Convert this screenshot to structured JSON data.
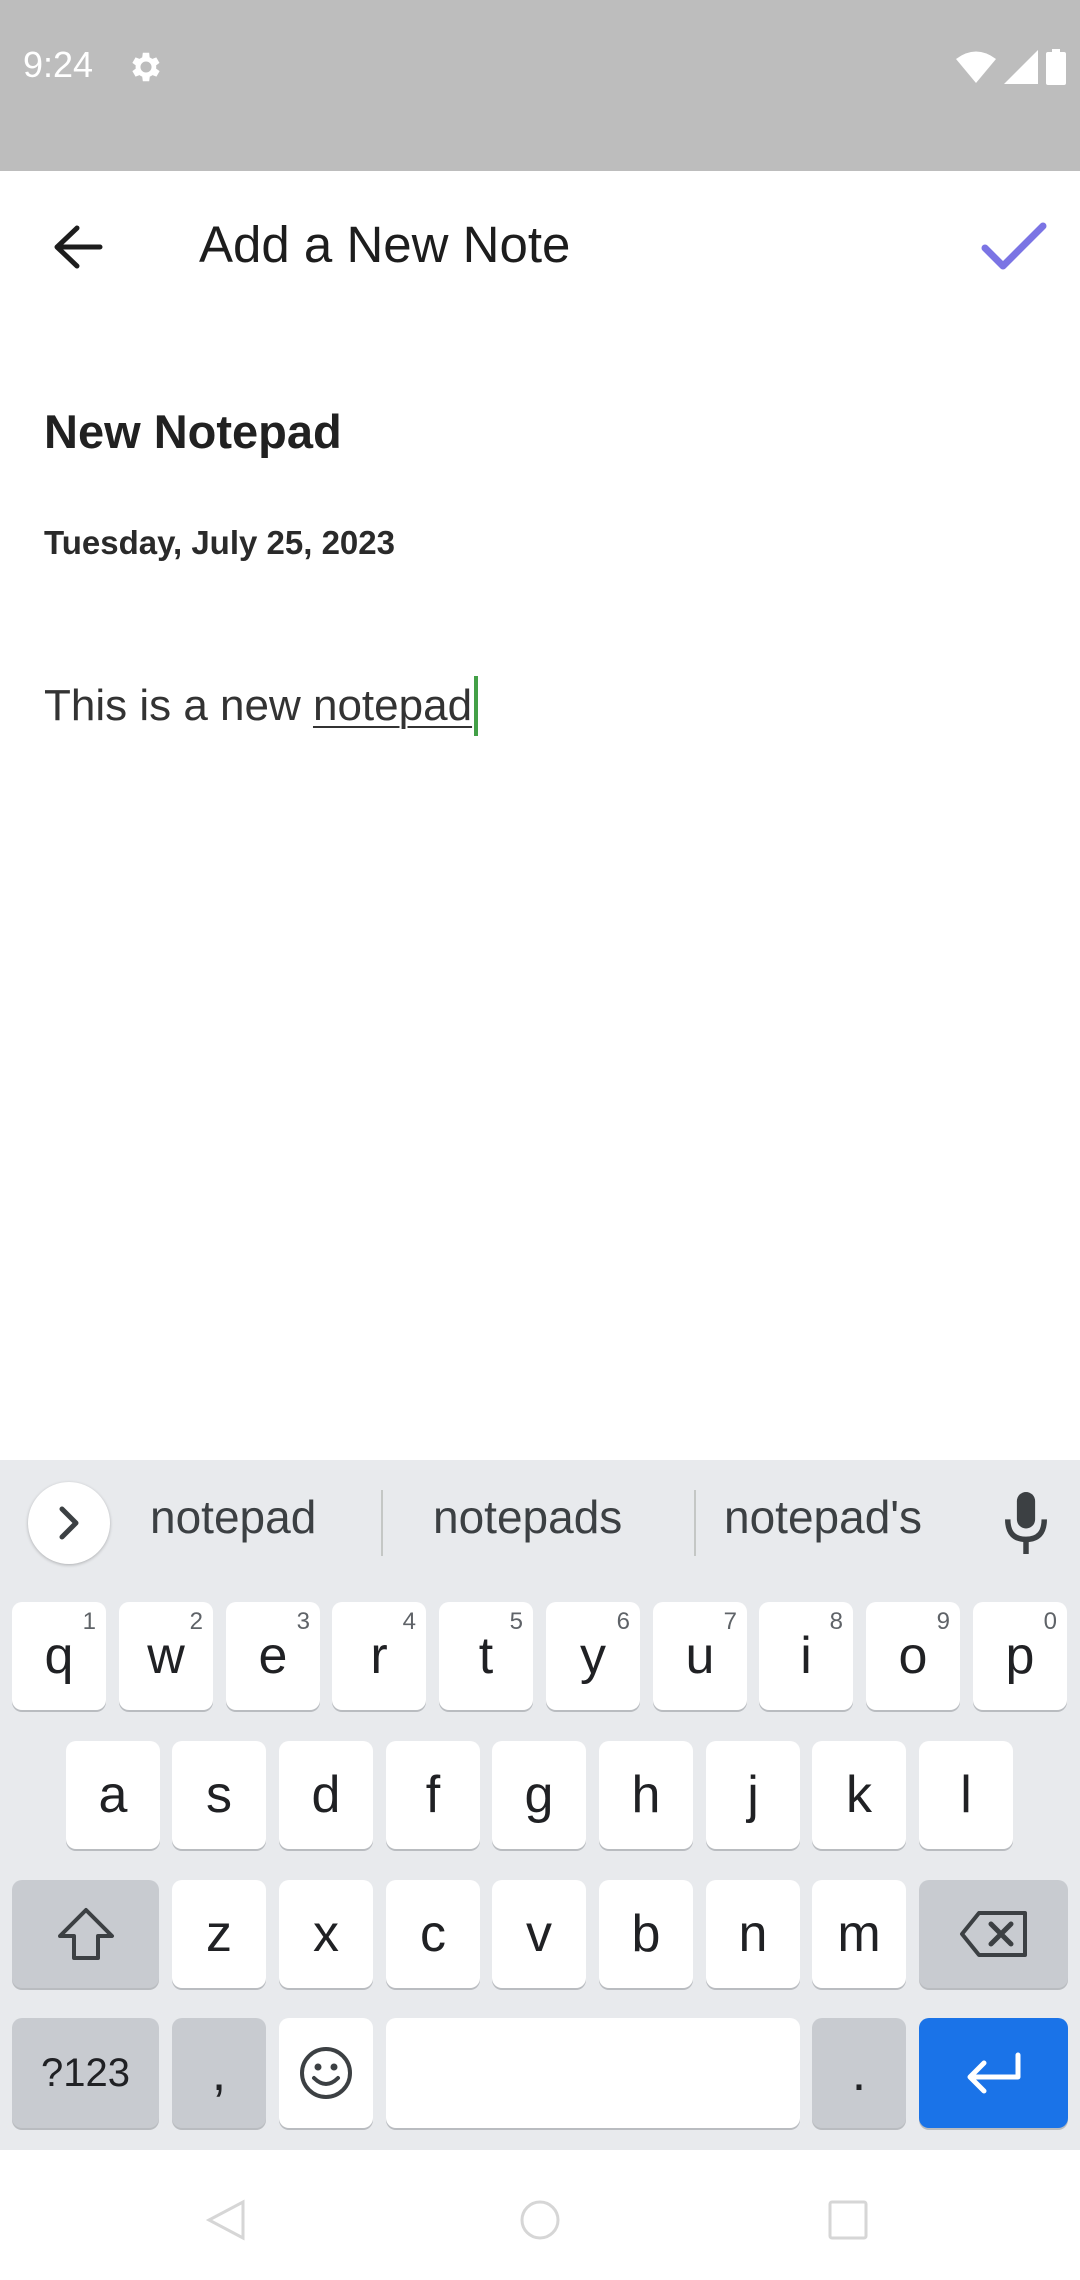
{
  "status_bar": {
    "time": "9:24",
    "icons": [
      "gear-icon",
      "wifi-icon",
      "cellular-signal-icon",
      "battery-icon"
    ]
  },
  "app_bar": {
    "title": "Add a New Note",
    "back_icon": "arrow-back-icon",
    "confirm_icon": "checkmark-icon",
    "accent_color": "#7b74e4"
  },
  "note": {
    "title": "New Notepad",
    "date": "Tuesday, July 25, 2023",
    "body_prefix": "This is a new ",
    "body_current_word": "notepad"
  },
  "keyboard": {
    "suggestions": [
      "notepad",
      "notepads",
      "notepad's"
    ],
    "row1": [
      {
        "key": "q",
        "hint": "1"
      },
      {
        "key": "w",
        "hint": "2"
      },
      {
        "key": "e",
        "hint": "3"
      },
      {
        "key": "r",
        "hint": "4"
      },
      {
        "key": "t",
        "hint": "5"
      },
      {
        "key": "y",
        "hint": "6"
      },
      {
        "key": "u",
        "hint": "7"
      },
      {
        "key": "i",
        "hint": "8"
      },
      {
        "key": "o",
        "hint": "9"
      },
      {
        "key": "p",
        "hint": "0"
      }
    ],
    "row2": [
      "a",
      "s",
      "d",
      "f",
      "g",
      "h",
      "j",
      "k",
      "l"
    ],
    "row3": [
      "z",
      "x",
      "c",
      "v",
      "b",
      "n",
      "m"
    ],
    "symbols_label": "?123",
    "comma_label": ",",
    "period_label": ".",
    "enter_color": "#1a73e8"
  },
  "nav_bar": {
    "icons": [
      "back-triangle-icon",
      "home-circle-icon",
      "recents-square-icon"
    ]
  }
}
